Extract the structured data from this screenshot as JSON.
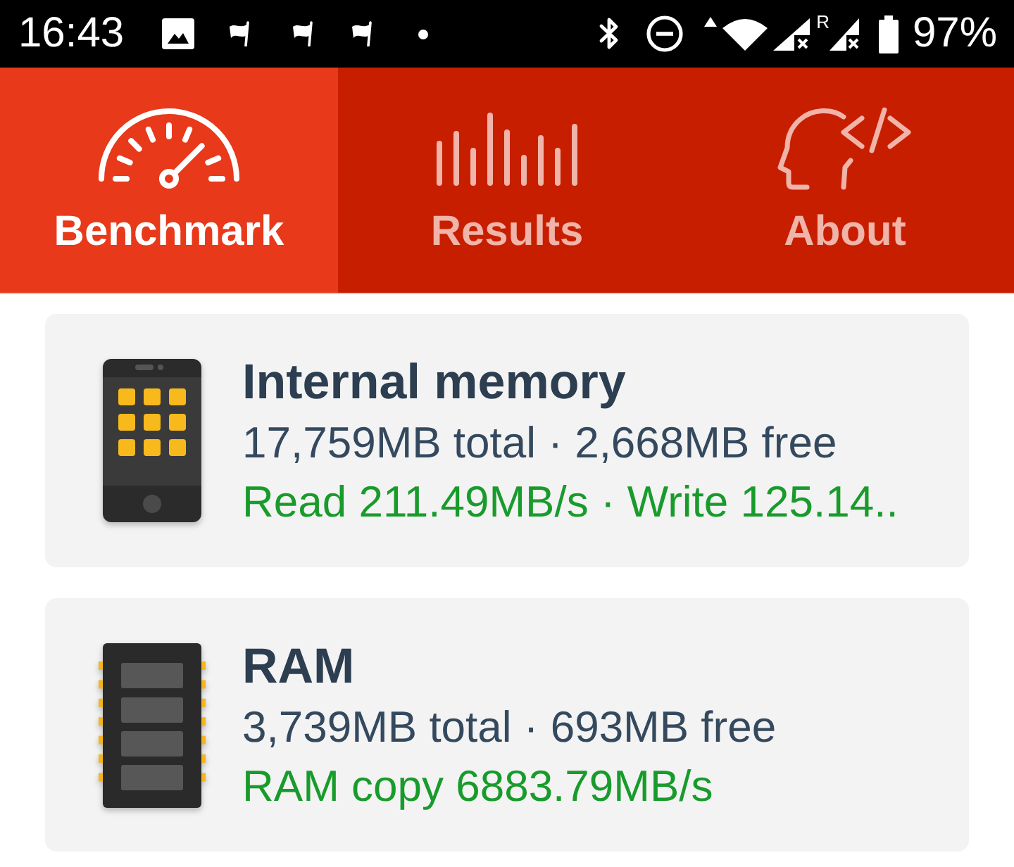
{
  "status_bar": {
    "time": "16:43",
    "roaming_label": "R",
    "battery": "97%"
  },
  "tabs": [
    {
      "label": "Benchmark",
      "selected": true
    },
    {
      "label": "Results",
      "selected": false
    },
    {
      "label": "About",
      "selected": false
    }
  ],
  "cards": [
    {
      "title": "Internal memory",
      "details": "17,759MB total · 2,668MB free",
      "speed": "Read 211.49MB/s · Write 125.14.."
    },
    {
      "title": "RAM",
      "details": "3,739MB total · 693MB free",
      "speed": "RAM copy 6883.79MB/s"
    }
  ]
}
